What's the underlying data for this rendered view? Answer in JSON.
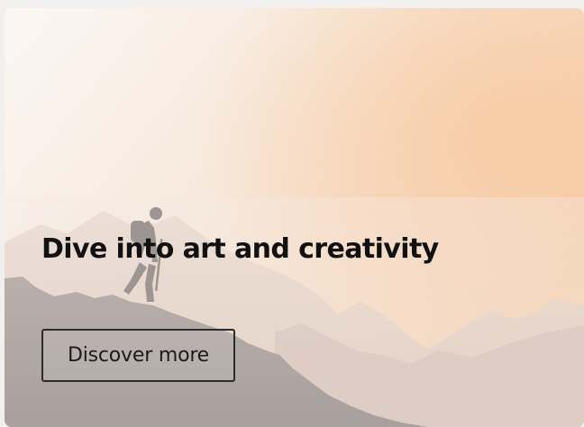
{
  "card": {
    "title": "Dive into art and creativity",
    "cta_label": "Discover more"
  },
  "colors": {
    "page_background": "#f1f0ef",
    "title_text": "#111111",
    "button_border": "#2b2b2b",
    "sky_top": "#f6e9dc",
    "sky_glow": "#f8c9a0",
    "mountain_far": "#dcc8bb",
    "mountain_near": "#8e8684"
  },
  "image": {
    "subject": "hiker-with-trekking-pole-on-mountain-ridge"
  }
}
